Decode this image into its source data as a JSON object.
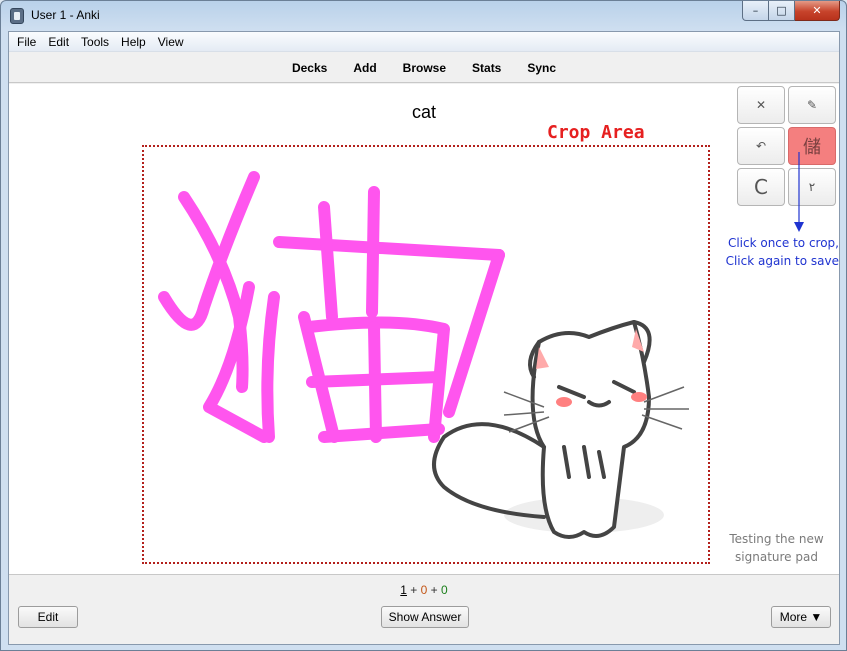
{
  "window": {
    "title": "User 1 - Anki",
    "minimize_glyph": "–",
    "maximize_glyph": "□",
    "close_glyph": "✕"
  },
  "menu": [
    "File",
    "Edit",
    "Tools",
    "Help",
    "View"
  ],
  "toolbar": [
    "Decks",
    "Add",
    "Browse",
    "Stats",
    "Sync"
  ],
  "card": {
    "question": "cat",
    "crop_label": "Crop Area"
  },
  "side_tools": {
    "buttons": [
      {
        "name": "close-icon",
        "glyph": "✕"
      },
      {
        "name": "eraser-icon",
        "glyph": "✎"
      },
      {
        "name": "undo-icon",
        "glyph": "↶"
      },
      {
        "name": "save-icon",
        "glyph": "儲",
        "active": true
      },
      {
        "name": "clear-icon",
        "glyph": "C"
      },
      {
        "name": "pen-width-icon",
        "glyph": "٢"
      }
    ],
    "note_line1": "Click once to crop,",
    "note_line2": "Click again to save",
    "signature_note_line1": "Testing the new",
    "signature_note_line2": "signature pad"
  },
  "counts": {
    "new": "1",
    "sep1": " + ",
    "learn": "0",
    "sep2": " + ",
    "review": "0"
  },
  "buttons": {
    "edit": "Edit",
    "show_answer": "Show Answer",
    "more": "More ▼"
  },
  "colors": {
    "ink": "#ff55ee",
    "crop_label": "#e62020",
    "note": "#1f33d0",
    "active_button": "#f47f7f"
  }
}
